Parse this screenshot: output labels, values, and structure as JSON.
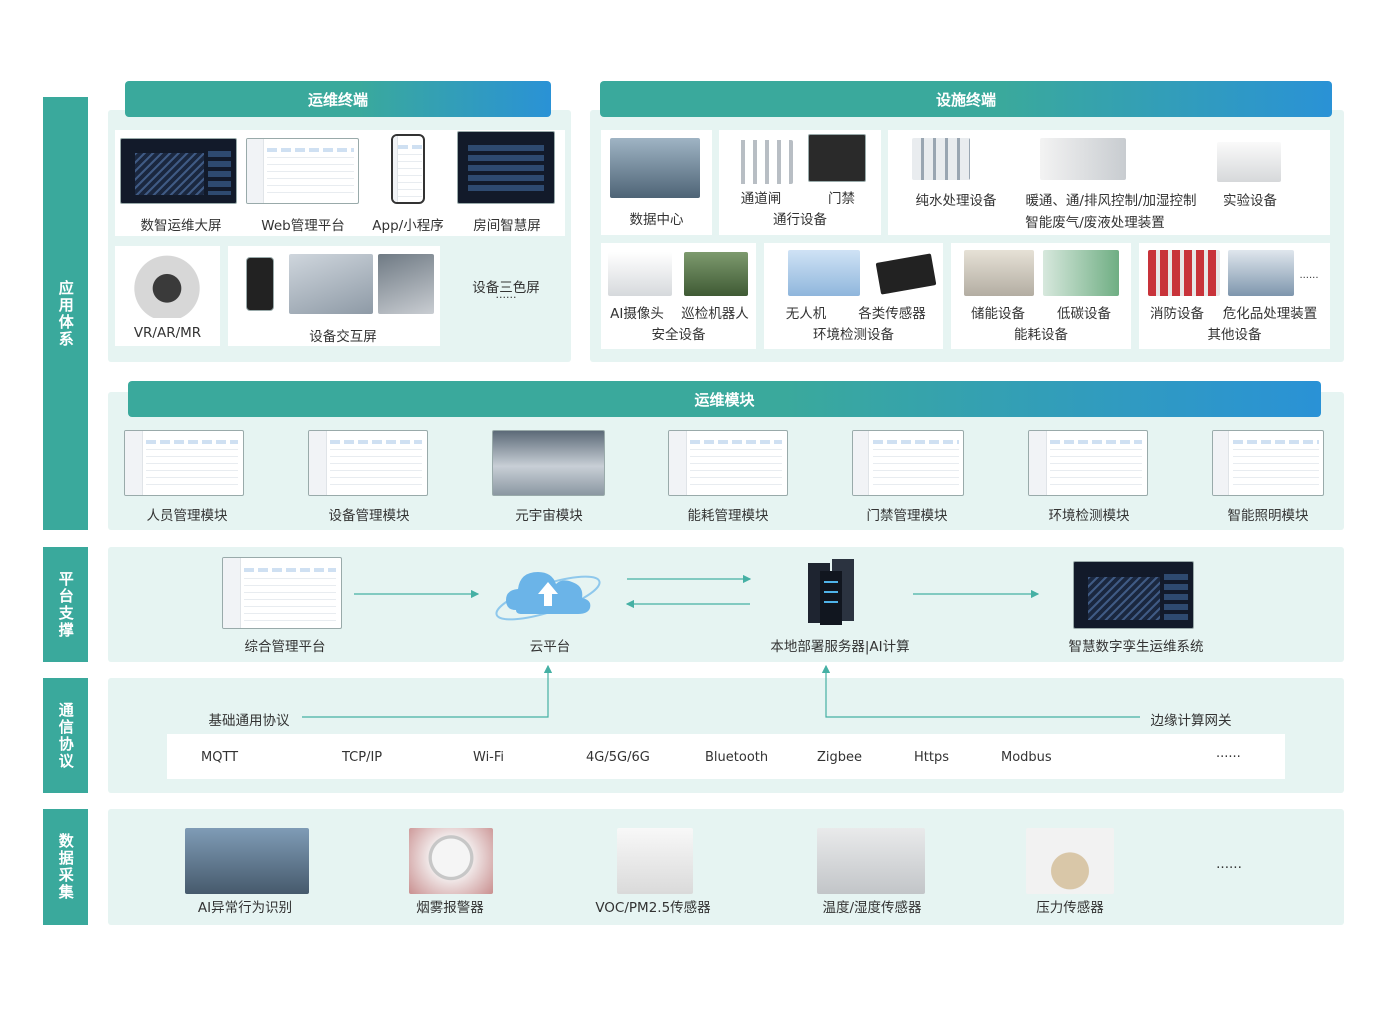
{
  "layers": {
    "application": "应用体系",
    "platform": "平台支撑",
    "communication": "通信协议",
    "collection": "数据采集"
  },
  "ops_terminal": {
    "title": "运维终端",
    "items": [
      "数智运维大屏",
      "Web管理平台",
      "App/小程序",
      "房间智慧屏",
      "VR/AR/MR",
      "设备交互屏",
      "设备三色屏"
    ],
    "ellipsis": "......"
  },
  "facility_terminal": {
    "title": "设施终端",
    "datacenter": "数据中心",
    "access": {
      "gate": "通道闸",
      "door": "门禁",
      "group": "通行设备"
    },
    "water": "纯水处理设备",
    "hvac": "暖通、通/排风控制/加湿控制",
    "lab": "实验设备",
    "waste": "智能废气/废液处理装置",
    "security": {
      "camera": "AI摄像头",
      "robot": "巡检机器人",
      "group": "安全设备"
    },
    "env": {
      "drone": "无人机",
      "sensors": "各类传感器",
      "group": "环境检测设备"
    },
    "energy": {
      "storage": "储能设备",
      "lowcarbon": "低碳设备",
      "group": "能耗设备"
    },
    "other": {
      "fire": "消防设备",
      "hazmat": "危化品处理装置",
      "group": "其他设备",
      "ellipsis": "......"
    }
  },
  "ops_modules": {
    "title": "运维模块",
    "items": [
      "人员管理模块",
      "设备管理模块",
      "元宇宙模块",
      "能耗管理模块",
      "门禁管理模块",
      "环境检测模块",
      "智能照明模块"
    ]
  },
  "platform": {
    "mgmt": "综合管理平台",
    "cloud": "云平台",
    "server": "本地部署服务器|AI计算",
    "twin": "智慧数字孪生运维系统"
  },
  "communication": {
    "basic": "基础通用协议",
    "edge": "边缘计算网关",
    "protocols": [
      "MQTT",
      "TCP/IP",
      "Wi-Fi",
      "4G/5G/6G",
      "Bluetooth",
      "Zigbee",
      "Https",
      "Modbus"
    ],
    "ellipsis": "......"
  },
  "collection": {
    "items": [
      "AI异常行为识别",
      "烟雾报警器",
      "VOC/PM2.5传感器",
      "温度/湿度传感器",
      "压力传感器"
    ],
    "ellipsis": "......"
  }
}
